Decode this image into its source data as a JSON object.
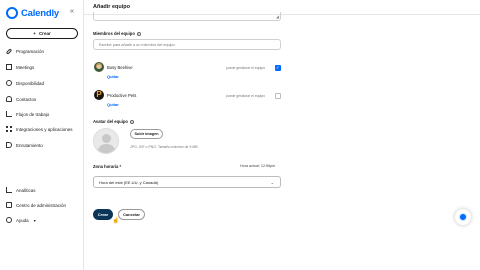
{
  "brand": {
    "name": "Calendly",
    "accent": "#006bff",
    "collapse_icon": "«"
  },
  "sidebar": {
    "create_label": "Crear",
    "create_icon": "+",
    "items": [
      {
        "label": "Programación",
        "icon": "link-icon"
      },
      {
        "label": "Meetings",
        "icon": "calendar-icon"
      },
      {
        "label": "Disponibilidad",
        "icon": "clock-icon"
      },
      {
        "label": "Contactos",
        "icon": "contacts-icon"
      },
      {
        "label": "Flujos de trabajo",
        "icon": "workflow-icon"
      },
      {
        "label": "Integraciones y aplicaciones",
        "icon": "apps-icon"
      },
      {
        "label": "Enrutamiento",
        "icon": "routing-icon"
      }
    ],
    "bottom_items": [
      {
        "label": "Analíticas",
        "icon": "analytics-icon"
      },
      {
        "label": "Centro de administración",
        "icon": "admin-icon"
      },
      {
        "label": "Ayuda",
        "icon": "help-icon",
        "caret": "▾"
      }
    ]
  },
  "page": {
    "title": "Añadir equipo",
    "members": {
      "label": "Miembros del equipo",
      "search_placeholder": "Escribe para añadir a un miembro del equipo",
      "list": [
        {
          "name": "Busy Beehive",
          "remove": "Quitar",
          "manage": "puede gestionar el equipo",
          "checked": true
        },
        {
          "name": "Productive Pets",
          "remove": "Quitar",
          "manage": "puede gestionar el equipo",
          "checked": false
        }
      ]
    },
    "team_avatar": {
      "label": "Avatar del equipo",
      "upload_label": "Subir imagen",
      "hint": "JPG, GIF o PNG. Tamaño máximo de 5 MB."
    },
    "timezone": {
      "label": "Zona horaria *",
      "current_time": "Hora actual: 12:56pm",
      "selected": "Hora del este (EE.UU. y Canadá)",
      "chevron": "⌄"
    },
    "actions": {
      "create": "Crear",
      "cancel": "Cancelar"
    },
    "check_mark": "✓",
    "resize_glyph": "◢"
  }
}
